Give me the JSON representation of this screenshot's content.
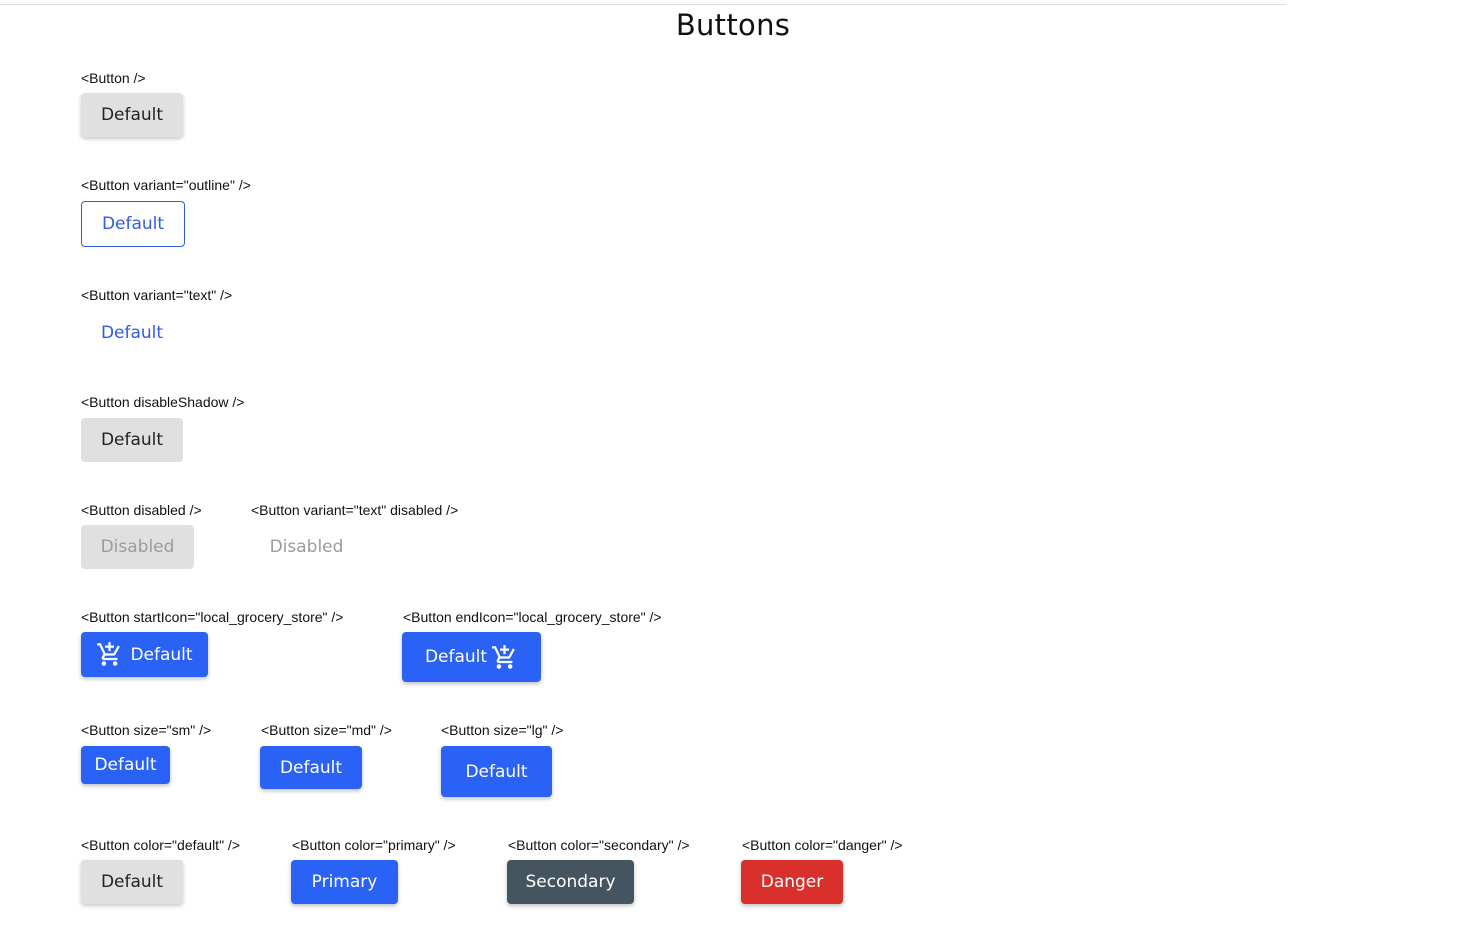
{
  "page": {
    "title": "Buttons"
  },
  "colors": {
    "primary": "#2a62f6",
    "secondary": "#455560",
    "danger": "#d9302c",
    "default": "#e0e0e0",
    "disabled_text": "#9b9b9b"
  },
  "sections": {
    "basic": {
      "label": "<Button />",
      "button": "Default"
    },
    "outline": {
      "label": "<Button variant=\"outline\" />",
      "button": "Default"
    },
    "text": {
      "label": "<Button variant=\"text\" />",
      "button": "Default"
    },
    "no_shadow": {
      "label": "<Button disableShadow />",
      "button": "Default"
    },
    "disabled": {
      "label": "<Button disabled />",
      "button": "Disabled"
    },
    "text_disabled": {
      "label": "<Button variant=\"text\" disabled />",
      "button": "Disabled"
    },
    "start_icon": {
      "label": "<Button startIcon=\"local_grocery_store\" />",
      "button": "Default",
      "icon": "local-grocery-store-icon"
    },
    "end_icon": {
      "label": "<Button endIcon=\"local_grocery_store\" />",
      "button": "Default",
      "icon": "local-grocery-store-icon"
    },
    "size_sm": {
      "label": "<Button size=\"sm\" />",
      "button": "Default"
    },
    "size_md": {
      "label": "<Button size=\"md\" />",
      "button": "Default"
    },
    "size_lg": {
      "label": "<Button size=\"lg\" />",
      "button": "Default"
    },
    "color_default": {
      "label": "<Button color=\"default\" />",
      "button": "Default"
    },
    "color_primary": {
      "label": "<Button color=\"primary\" />",
      "button": "Primary"
    },
    "color_secondary": {
      "label": "<Button color=\"secondary\" />",
      "button": "Secondary"
    },
    "color_danger": {
      "label": "<Button color=\"danger\" />",
      "button": "Danger"
    }
  }
}
